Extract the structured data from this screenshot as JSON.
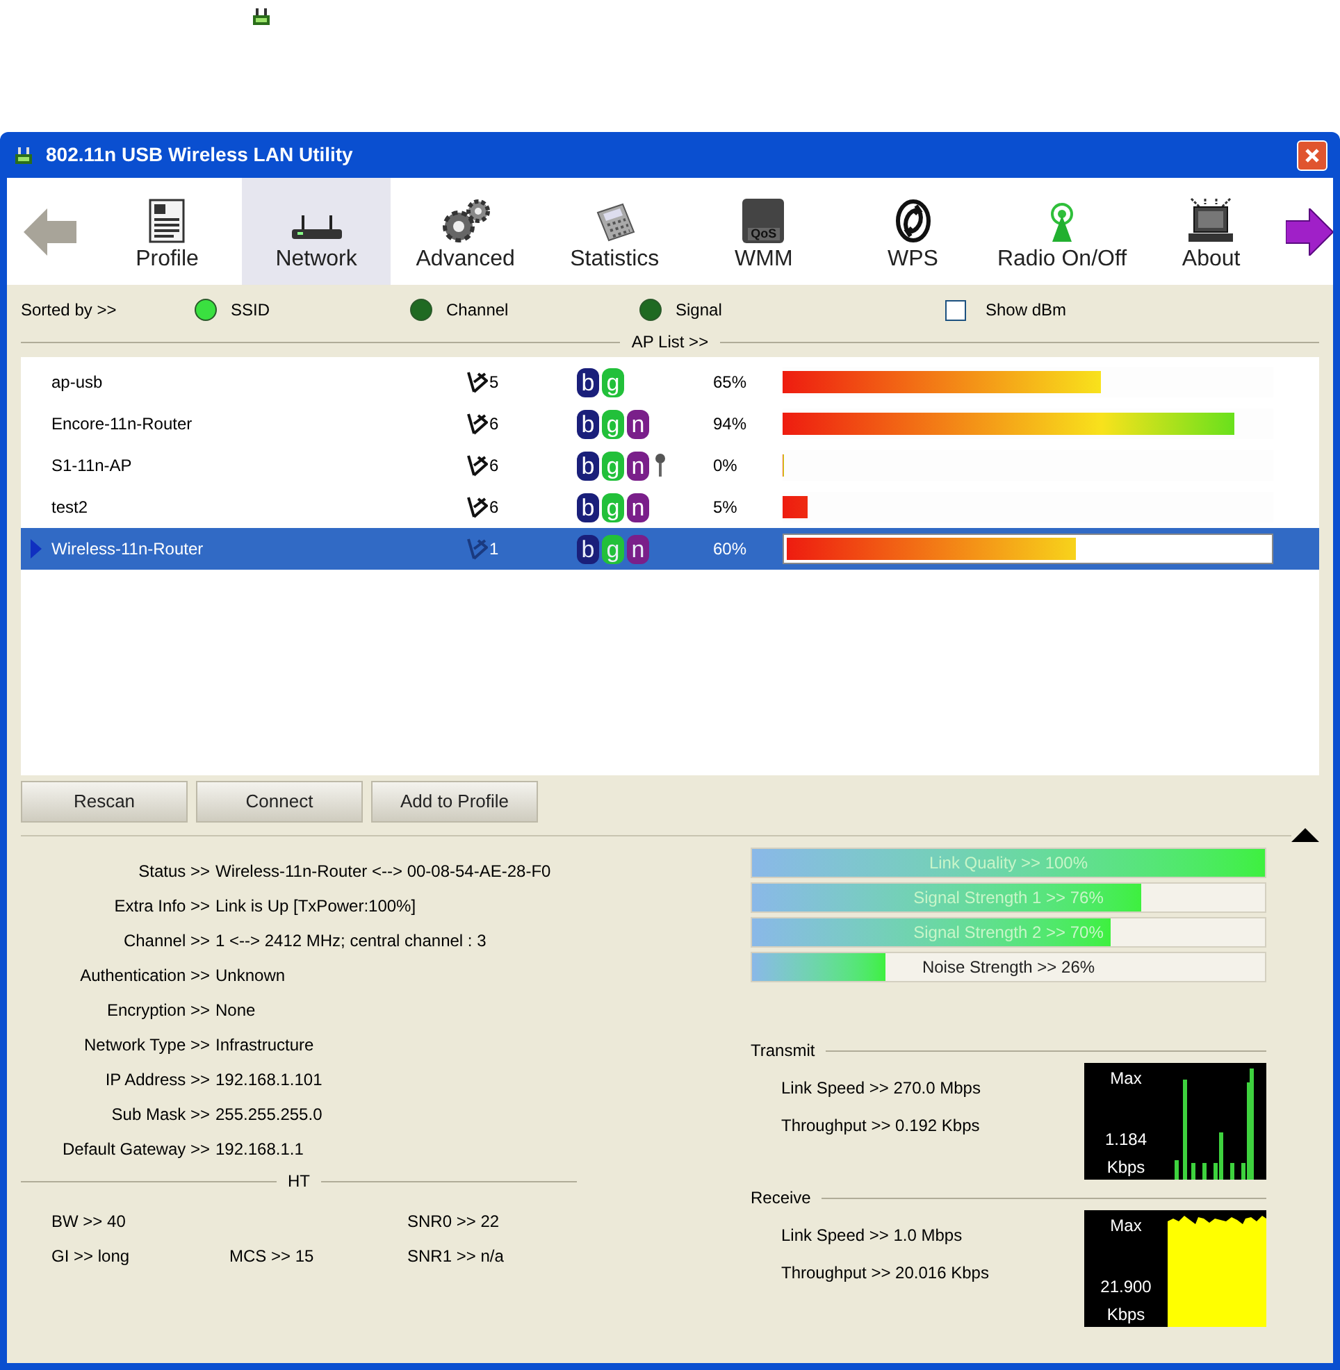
{
  "window": {
    "title": "802.11n USB Wireless LAN Utility"
  },
  "toolbar": {
    "items": [
      {
        "label": "Profile",
        "selected": false
      },
      {
        "label": "Network",
        "selected": true
      },
      {
        "label": "Advanced",
        "selected": false
      },
      {
        "label": "Statistics",
        "selected": false
      },
      {
        "label": "WMM",
        "selected": false,
        "icon_text": "QoS"
      },
      {
        "label": "WPS",
        "selected": false
      },
      {
        "label": "Radio On/Off",
        "selected": false
      },
      {
        "label": "About",
        "selected": false
      }
    ]
  },
  "sort": {
    "label": "Sorted by >>",
    "options": [
      {
        "label": "SSID",
        "selected": true
      },
      {
        "label": "Channel",
        "selected": false
      },
      {
        "label": "Signal",
        "selected": false
      }
    ],
    "show_dbm": {
      "label": "Show dBm",
      "checked": false
    }
  },
  "ap_list": {
    "title": "AP List >>",
    "rows": [
      {
        "ssid": "ap-usb",
        "channel": "5",
        "modes": [
          {
            "label": "b",
            "color": "#1a1f7a"
          },
          {
            "label": "g",
            "color": "#22c03a"
          }
        ],
        "secured": false,
        "signal": "65%",
        "level": 0.65,
        "selected": false
      },
      {
        "ssid": "Encore-11n-Router",
        "channel": "6",
        "modes": [
          {
            "label": "b",
            "color": "#1a1f7a"
          },
          {
            "label": "g",
            "color": "#22c03a"
          },
          {
            "label": "n",
            "color": "#7a1f8a"
          }
        ],
        "secured": false,
        "signal": "94%",
        "level": 0.92,
        "selected": false
      },
      {
        "ssid": "S1-11n-AP",
        "channel": "6",
        "modes": [
          {
            "label": "b",
            "color": "#1a1f7a"
          },
          {
            "label": "g",
            "color": "#22c03a"
          },
          {
            "label": "n",
            "color": "#7a1f8a"
          }
        ],
        "secured": true,
        "signal": "0%",
        "level": 0,
        "selected": false
      },
      {
        "ssid": "test2",
        "channel": "6",
        "modes": [
          {
            "label": "b",
            "color": "#1a1f7a"
          },
          {
            "label": "g",
            "color": "#22c03a"
          },
          {
            "label": "n",
            "color": "#7a1f8a"
          }
        ],
        "secured": false,
        "signal": "5%",
        "level": 0.05,
        "selected": false
      },
      {
        "ssid": "Wireless-11n-Router",
        "channel": "1",
        "modes": [
          {
            "label": "b",
            "color": "#1a1f7a"
          },
          {
            "label": "g",
            "color": "#22c03a"
          },
          {
            "label": "n",
            "color": "#7a1f8a"
          }
        ],
        "secured": false,
        "signal": "60%",
        "level": 0.6,
        "selected": true
      }
    ]
  },
  "buttons": [
    "Rescan",
    "Connect",
    "Add to Profile"
  ],
  "details": [
    {
      "label": "Status >>",
      "value": "Wireless-11n-Router <--> 00-08-54-AE-28-F0"
    },
    {
      "label": "Extra Info >>",
      "value": "Link is Up [TxPower:100%]"
    },
    {
      "label": "Channel >>",
      "value": "1 <--> 2412 MHz; central channel : 3"
    },
    {
      "label": "Authentication >>",
      "value": "Unknown"
    },
    {
      "label": "Encryption >>",
      "value": "None"
    },
    {
      "label": "Network Type >>",
      "value": "Infrastructure"
    },
    {
      "label": "IP Address >>",
      "value": "192.168.1.101"
    },
    {
      "label": "Sub Mask >>",
      "value": "255.255.255.0"
    },
    {
      "label": "Default Gateway >>",
      "value": "192.168.1.1"
    }
  ],
  "ht": {
    "title": "HT",
    "rows": [
      {
        "left": "BW >> 40",
        "right": "SNR0 >> 22"
      },
      {
        "left": "GI >> long",
        "middle": "MCS >> 15",
        "right": "SNR1 >> n/a"
      }
    ]
  },
  "meters": [
    {
      "label": "Link Quality >> 100%",
      "level": 1
    },
    {
      "label": "Signal Strength 1 >> 76%",
      "level": 0.76
    },
    {
      "label": "Signal Strength 2 >> 70%",
      "level": 0.7
    },
    {
      "label": "Noise Strength >> 26%",
      "level": 0.26
    }
  ],
  "traffic": [
    {
      "kind": "transmit",
      "title": "Transmit",
      "link_speed": "Link Speed >> 270.0 Mbps",
      "throughput": "Throughput >> 0.192 Kbps",
      "graph": {
        "max": "Max",
        "reading": "1.184",
        "unit": "Kbps"
      }
    },
    {
      "kind": "receive",
      "title": "Receive",
      "link_speed": "Link Speed >> 1.0 Mbps",
      "throughput": "Throughput >> 20.016 Kbps",
      "graph": {
        "max": "Max",
        "reading": "21.900",
        "unit": "Kbps"
      }
    }
  ]
}
